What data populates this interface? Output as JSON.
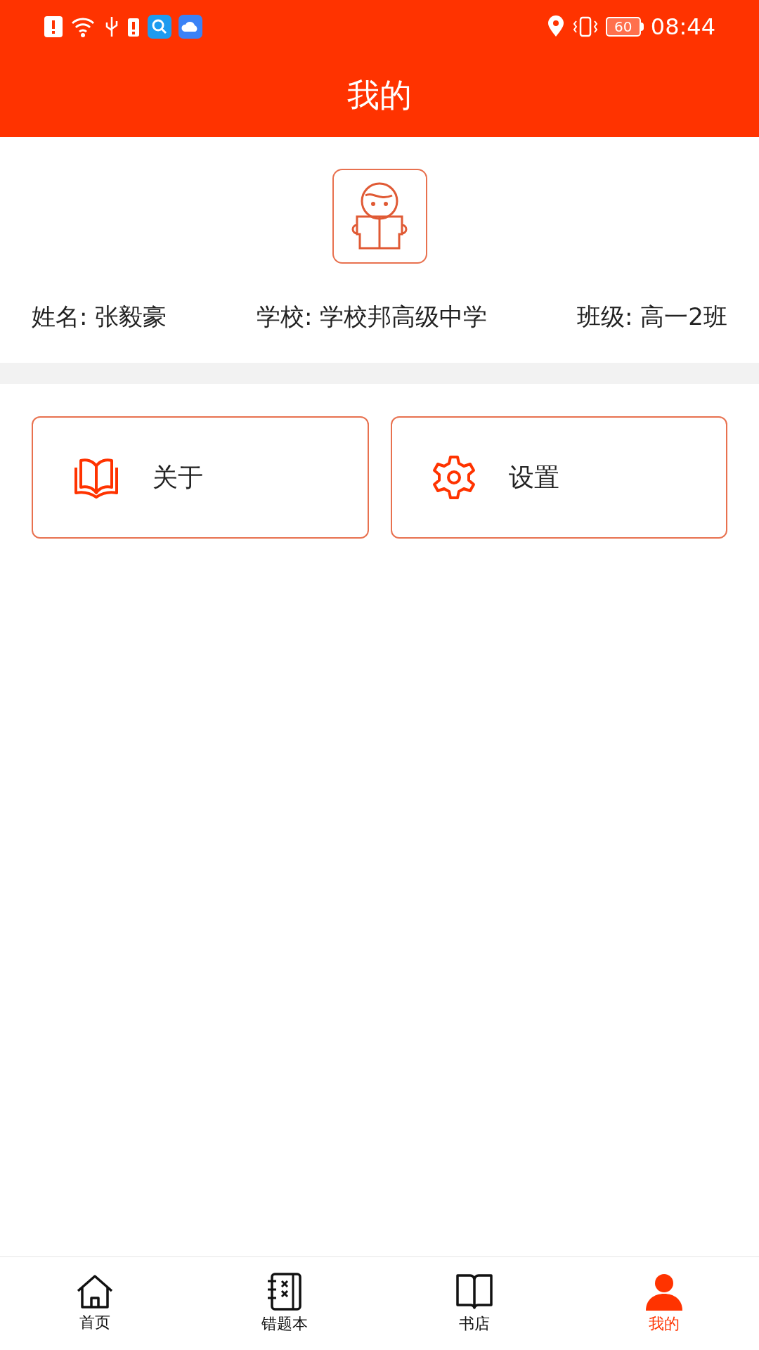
{
  "status_bar": {
    "battery": "60",
    "time": "08:44"
  },
  "header": {
    "title": "我的"
  },
  "profile": {
    "fields": [
      {
        "label": "姓名:",
        "value": "张毅豪"
      },
      {
        "label": "学校:",
        "value": "学校邦高级中学"
      },
      {
        "label": "班级:",
        "value": "高一2班"
      }
    ]
  },
  "actions": [
    {
      "kind": "about",
      "label": "关于"
    },
    {
      "kind": "settings",
      "label": "设置"
    }
  ],
  "tabs": [
    {
      "kind": "home",
      "label": "首页",
      "selected": false
    },
    {
      "kind": "mistakes",
      "label": "错题本",
      "selected": false
    },
    {
      "kind": "bookstore",
      "label": "书店",
      "selected": false
    },
    {
      "kind": "me",
      "label": "我的",
      "selected": true
    }
  ]
}
